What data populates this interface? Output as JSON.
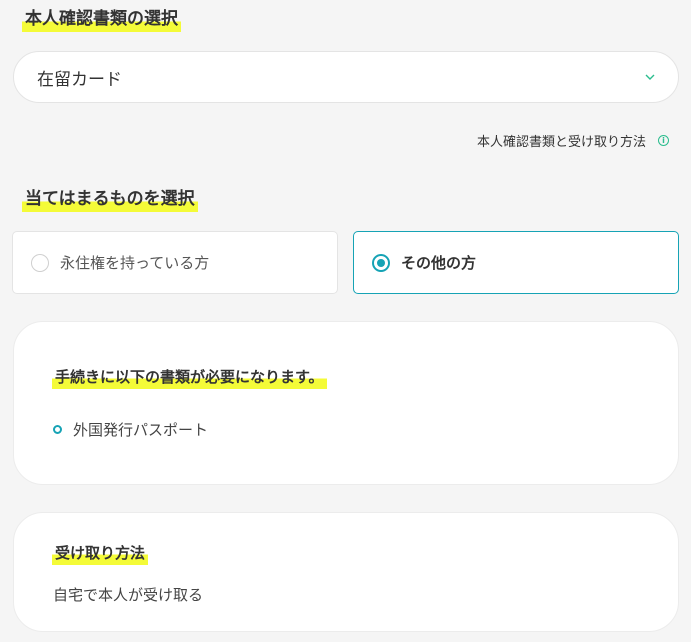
{
  "id_section": {
    "title": "本人確認書類の選択",
    "select_value": "在留カード",
    "help_link": "本人確認書類と受け取り方法",
    "info_icon": "i"
  },
  "applicable_section": {
    "title": "当てはまるものを選択",
    "options": [
      {
        "label": "永住権を持っている方",
        "selected": false
      },
      {
        "label": "その他の方",
        "selected": true
      }
    ]
  },
  "documents_card": {
    "title": "手続きに以下の書類が必要になります。",
    "items": [
      "外国発行パスポート"
    ]
  },
  "method_card": {
    "title": "受け取り方法",
    "text": "自宅で本人が受け取る"
  },
  "colors": {
    "accent": "#16a3b5",
    "highlight": "#f4fb38",
    "info": "#2bbd8e"
  }
}
